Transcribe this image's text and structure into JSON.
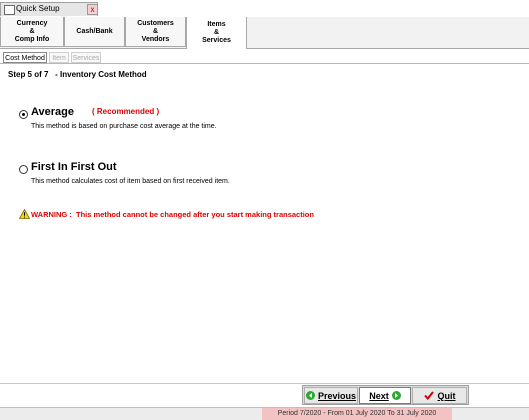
{
  "window": {
    "title": "Quick Setup",
    "close_label": "x"
  },
  "main_tabs": [
    {
      "label": "Currency\n&\nComp Info"
    },
    {
      "label": "Cash/Bank"
    },
    {
      "label": "Customers\n&\nVendors"
    },
    {
      "label": "Items\n&\nServices",
      "active": true
    }
  ],
  "sub_tabs": [
    {
      "label": "Cost Method",
      "active": true
    },
    {
      "label": "Item"
    },
    {
      "label": "Services"
    }
  ],
  "step_text": "Step 5 of 7   - Inventory Cost Method",
  "options": [
    {
      "label": "Average",
      "checked": true,
      "badge": "( Recommended )",
      "description": "This method is based on purchase cost average at the time."
    },
    {
      "label": "First In First Out",
      "checked": false,
      "description": "This method calculates cost of item based on first received item."
    }
  ],
  "warning": "WARNING :  This method cannot be changed after you start making transaction",
  "buttons": {
    "previous": "Previous",
    "next": "Next",
    "quit": "Quit"
  },
  "status": {
    "period": "Period 7/2020 - From 01 July 2020 To 31 July 2020"
  },
  "colors": {
    "warning": "#e00000",
    "recommended": "#e00000",
    "status_period_bg": "#f3c2c2",
    "nav_icon": "#2ea82e",
    "quit_check": "#d00000"
  },
  "icons": [
    "app-icon",
    "close-icon",
    "warning-icon",
    "previous-arrow-icon",
    "next-arrow-icon",
    "check-icon"
  ]
}
